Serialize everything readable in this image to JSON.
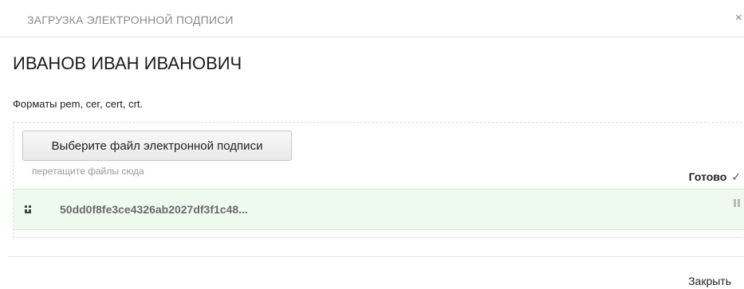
{
  "dialog": {
    "title": "ЗАГРУЗКА ЭЛЕКТРОННОЙ ПОДПИСИ",
    "close_glyph": "×"
  },
  "owner_name": "ИВАНОВ ИВАН ИВАНОВИЧ",
  "formats_text": "Форматы pem, cer, cert, crt.",
  "upload": {
    "choose_button_label": "Выберите файл электронной подписи",
    "drop_hint": "перетащите файлы сюда",
    "status_label": "Готово",
    "status_icon": "✓"
  },
  "files": [
    {
      "name": "50dd0f8fe3ce4326ab2027df3f1c48..."
    }
  ],
  "footer": {
    "close_label": "Закрыть"
  },
  "colors": {
    "file_row_bg": "#effaef",
    "title_gray": "#8a8a8a"
  }
}
